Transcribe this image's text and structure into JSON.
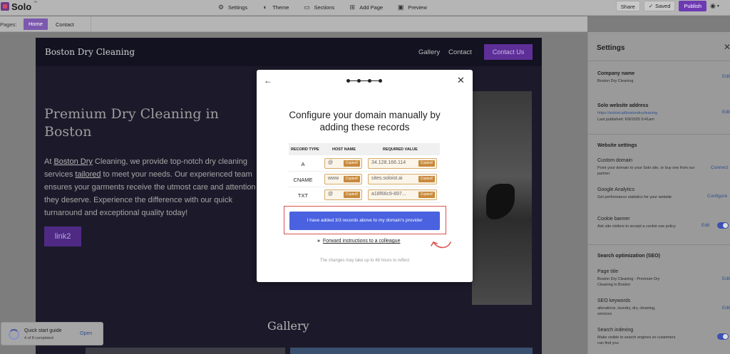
{
  "topbar": {
    "brand": "Solo",
    "tm": "™",
    "nav": [
      {
        "label": "Settings",
        "icon": "gear-icon"
      },
      {
        "label": "Theme",
        "icon": "palette-icon"
      },
      {
        "label": "Sections",
        "icon": "sections-icon"
      },
      {
        "label": "Add Page",
        "icon": "add-page-icon"
      },
      {
        "label": "Preview",
        "icon": "preview-icon"
      }
    ],
    "share": "Share",
    "saved": "Saved",
    "publish": "Publish"
  },
  "pagesbar": {
    "label": "Pages:",
    "tabs": [
      "Home",
      "Contact"
    ]
  },
  "site": {
    "brand": "Boston Dry Cleaning",
    "nav": [
      "Gallery",
      "Contact"
    ],
    "cta": "Contact Us",
    "hero_title": "Premium Dry Cleaning in Boston",
    "hero_text": {
      "p1": "At ",
      "link1": "Boston Dry",
      "p2": " Cleaning, we provide top-notch dry cleaning",
      "p3": "services ",
      "link2": "tailored",
      "p4": " to meet your needs. Our experienced team",
      "line3": "ensures your garments receive the utmost care and attention",
      "line4": "they deserve. Experience the difference with our quick",
      "line5": "turnaround and exceptional quality today!"
    },
    "hero_button": "link2",
    "gallery_title": "Gallery"
  },
  "settings": {
    "title": "Settings",
    "company_name_label": "Company name",
    "company_name_value": "Boston Dry Cleaning",
    "address_label": "Solo website address",
    "address_value": "https://soloist.ai/bostondrycleaning",
    "last_published": "Last published: 6/9/2025 9:41am",
    "website_settings": "Website settings",
    "custom_domain_label": "Custom domain",
    "custom_domain_desc": "Point your domain to your Solo site, or buy one from our partner",
    "connect": "Connect",
    "analytics_label": "Google Analytics",
    "analytics_desc": "Get performance statistics for your website",
    "configure": "Configure",
    "cookie_label": "Cookie banner",
    "cookie_desc": "Ask site visitors to accept a cookie use policy",
    "seo_heading": "Search optimization (SEO)",
    "page_title_label": "Page title",
    "page_title_value": "Boston Dry Cleaning - Premium Dry Cleaning in Boston",
    "seo_keywords_label": "SEO keywords",
    "seo_keywords_value": "alterations, laundry, dry, cleaning, services",
    "indexing_label": "Search indexing",
    "indexing_desc": "Make visible to search engines so customers can find you",
    "edit": "Edit"
  },
  "quickstart": {
    "title": "Quick start guide",
    "progress": "4 of 8 completed",
    "progress_fraction": 0.5,
    "open": "Open"
  },
  "modal": {
    "title": "Configure your domain manually by adding these records",
    "columns": [
      "RECORD TYPE",
      "HOST NAME",
      "REQUIRED VALUE"
    ],
    "records": [
      {
        "type": "A",
        "host": "@",
        "value": "34.128.166.114"
      },
      {
        "type": "CNAME",
        "host": "www",
        "value": "sites.soloist.ai"
      },
      {
        "type": "TXT",
        "host": "@",
        "value": "a18f66c9-897..."
      }
    ],
    "copied": "Copied!",
    "confirm_button": "I have added 3/3 records above to my domain's provider",
    "forward_arrows": "»",
    "forward_link": "Forward instructions to a colleague",
    "changes_note": "The changes may take up to 48 hours to reflect",
    "highlight_color": "#d9534f",
    "accent_color": "#4a62e0"
  }
}
